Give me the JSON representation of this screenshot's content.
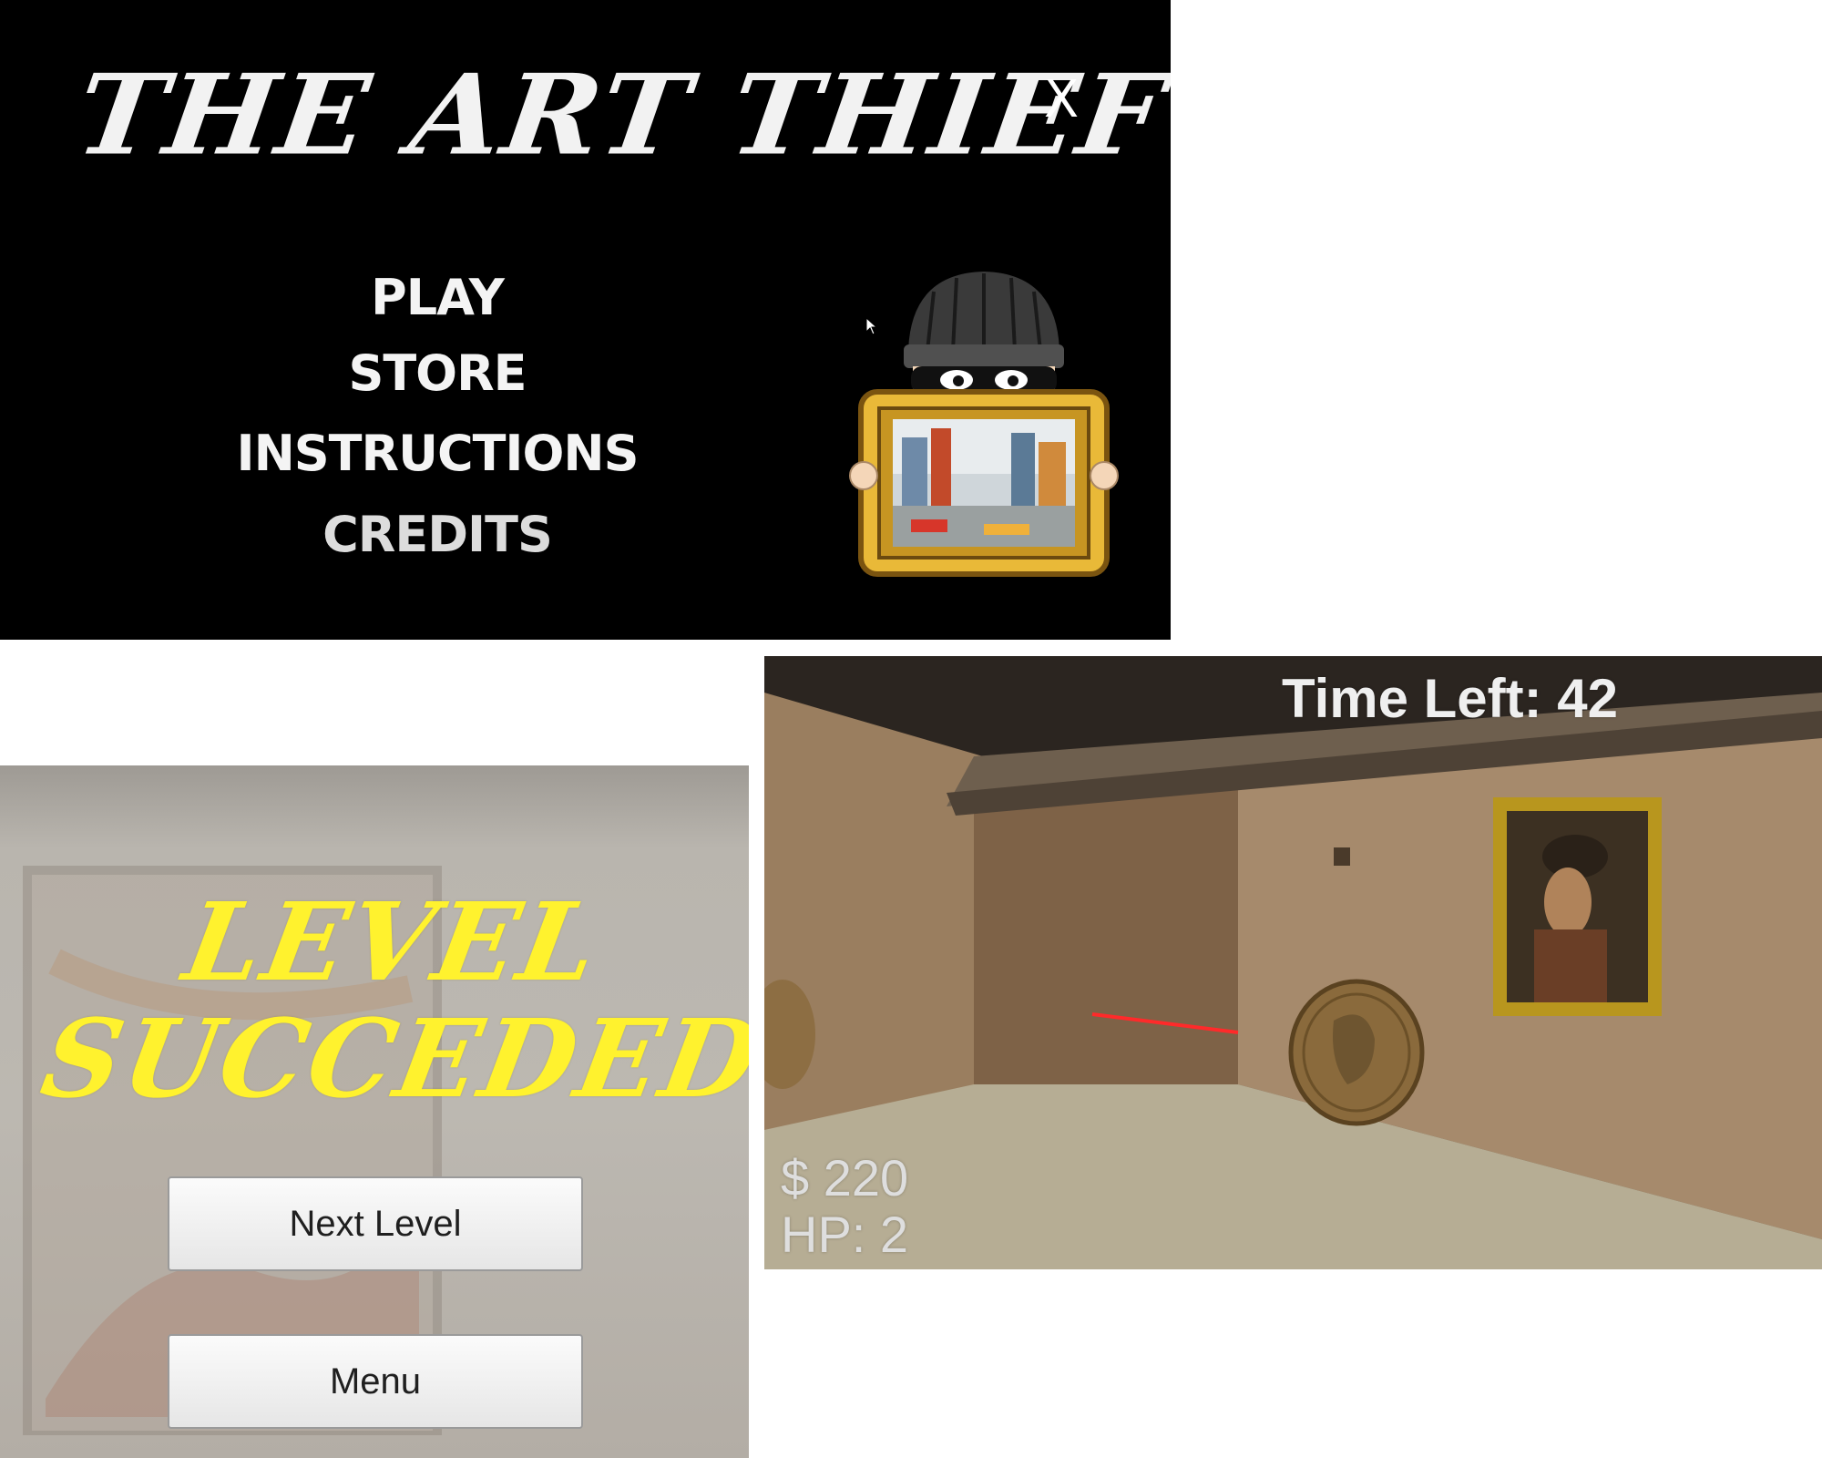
{
  "main_menu": {
    "title": "THE ART THIEF",
    "close_label": "X",
    "items": [
      {
        "label": "PLAY"
      },
      {
        "label": "STORE"
      },
      {
        "label": "INSTRUCTIONS"
      },
      {
        "label": "CREDITS"
      }
    ]
  },
  "level_result": {
    "title_line1": "LEVEL",
    "title_line2": "SUCCEDED",
    "next_label": "Next Level",
    "menu_label": "Menu"
  },
  "gameplay": {
    "time_left": "Time Left: 42",
    "money": "$ 220",
    "hp": "HP: 2"
  },
  "colors": {
    "menu_bg": "#000000",
    "title_accent": "#fff22e",
    "hud_text": "#e6e6e6"
  }
}
